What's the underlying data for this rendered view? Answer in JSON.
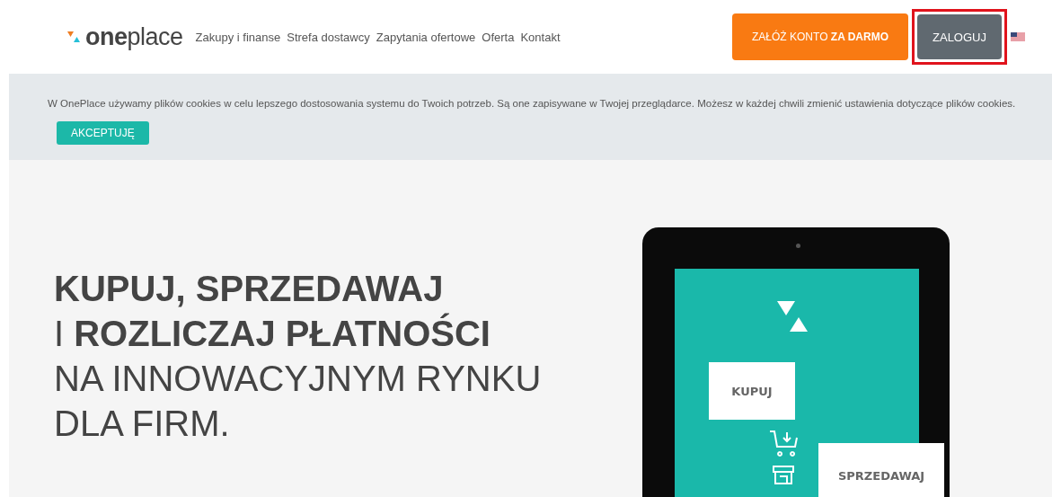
{
  "header": {
    "logo": "**one**place",
    "nav": [
      "Zakupy i finanse",
      "Strefa dostawcy",
      "Zapytania ofertowe",
      "Oferta",
      "Kontakt"
    ],
    "signup_button": "ZAŁÓŻ KONTO **ZA DARMO**",
    "login_button": {
      "label": "ZALOGUJ",
      "highlighted": true
    }
  },
  "cookie_bar": {
    "text": "W OnePlace używamy plików cookies w celu lepszego dostosowania systemu do Twoich potrzeb. Są one zapisywane w Twojej przeglądarce. Możesz w każdej chwili zmienić ustawienia dotyczące plików cookies.",
    "button": "AKCEPTUJĘ"
  },
  "hero": {
    "lines": [
      {
        "text": "KUPUJ, SPRZEDAWAJ",
        "bold": true
      },
      {
        "text": "I **ROZLICZAJ PŁATNOŚCI**",
        "bold": false
      },
      {
        "text": "NA INNOWACYJNYM RYNKU",
        "bold": false
      },
      {
        "text": "DLA FIRM.",
        "bold": false
      }
    ],
    "tablet": {
      "bubbles": [
        "KUPUJ",
        "SPRZEDAWAJ"
      ]
    }
  }
}
